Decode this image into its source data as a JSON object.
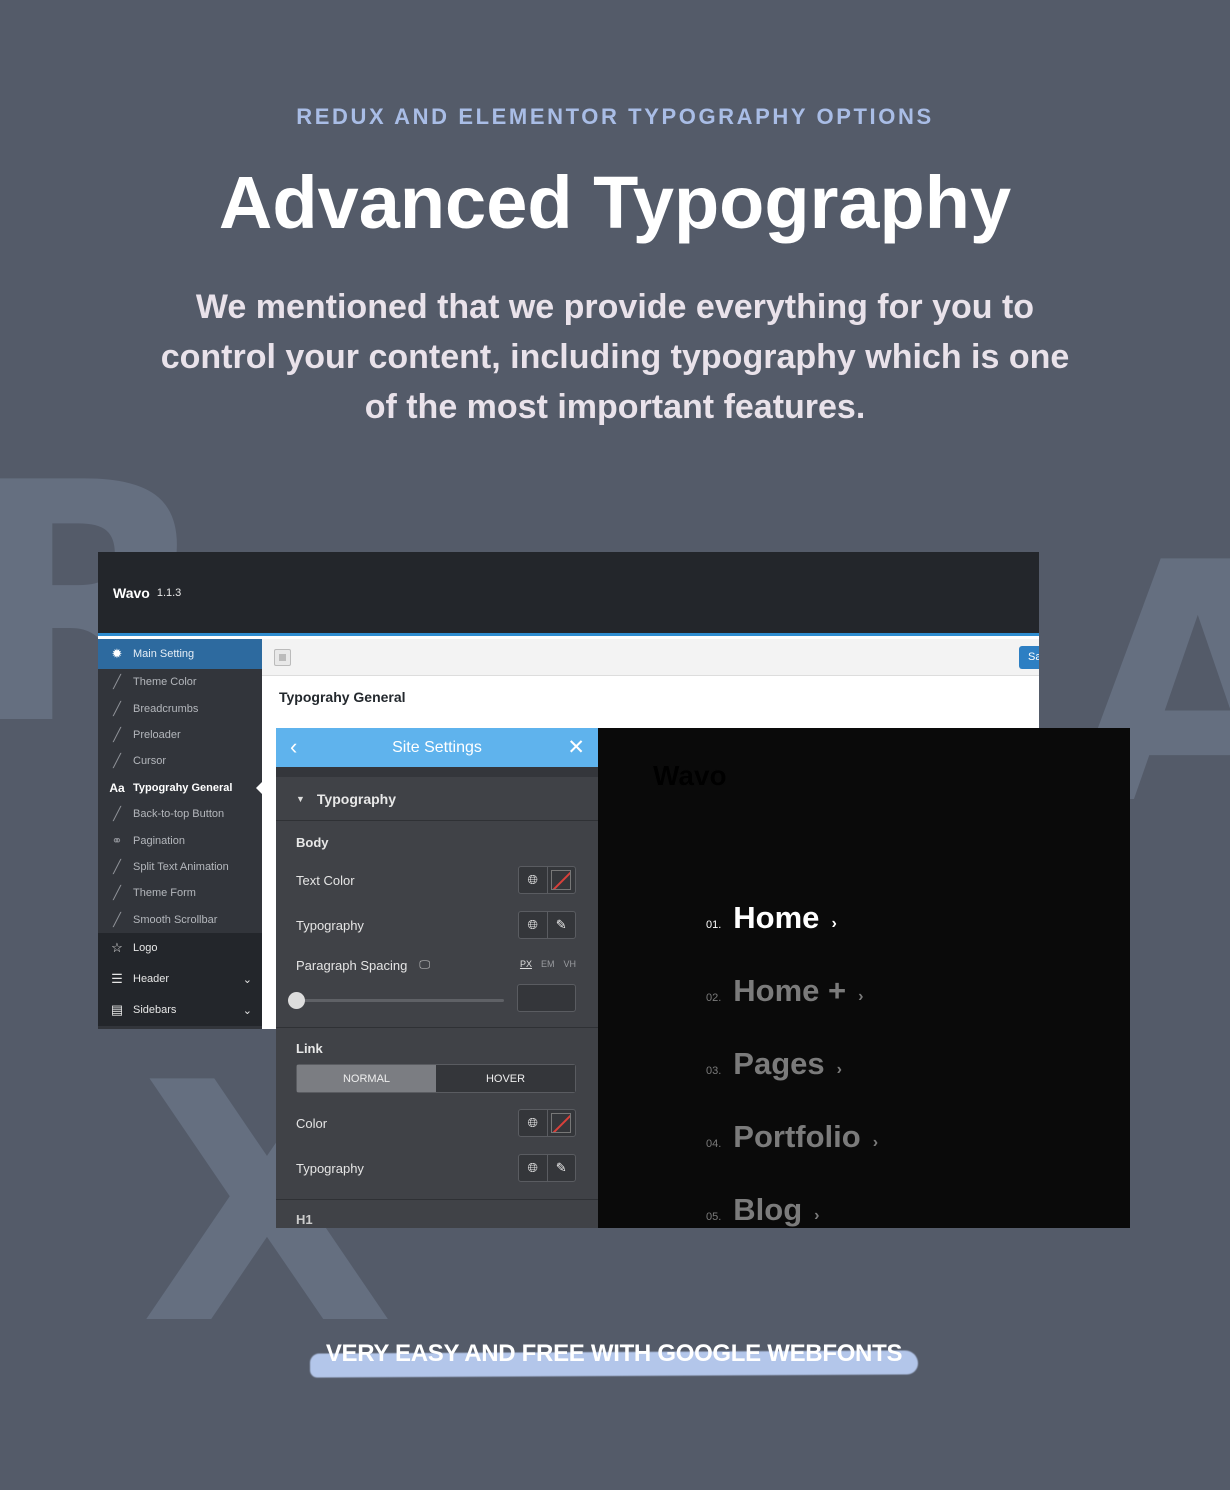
{
  "hero": {
    "eyebrow": "REDUX AND ELEMENTOR TYPOGRAPHY OPTIONS",
    "title": "Advanced Typography",
    "subtitle": "We mentioned that we provide everything for you to control your content, including typography which is one of the most important features."
  },
  "background_letters": [
    "R",
    "A",
    "X"
  ],
  "redux": {
    "brand": "Wavo",
    "version": "1.1.3",
    "save_label": "Save",
    "heading": "Typograhy General",
    "sidebar": [
      {
        "label": "Main Setting",
        "icon": "gear-icon"
      },
      {
        "label": "Theme Color",
        "icon": "brush-icon"
      },
      {
        "label": "Breadcrumbs",
        "icon": "brush-icon"
      },
      {
        "label": "Preloader",
        "icon": "brush-icon"
      },
      {
        "label": "Cursor",
        "icon": "brush-icon"
      },
      {
        "label": "Typograhy General",
        "icon": "font-icon",
        "icon_text": "Aa"
      },
      {
        "label": "Back-to-top Button",
        "icon": "brush-icon"
      },
      {
        "label": "Pagination",
        "icon": "link-icon"
      },
      {
        "label": "Split Text Animation",
        "icon": "brush-icon"
      },
      {
        "label": "Theme Form",
        "icon": "brush-icon"
      },
      {
        "label": "Smooth Scrollbar",
        "icon": "brush-icon"
      },
      {
        "label": "Logo",
        "icon": "star-icon"
      },
      {
        "label": "Header",
        "icon": "menu-icon"
      },
      {
        "label": "Sidebars",
        "icon": "grid-icon"
      }
    ]
  },
  "elementor": {
    "title": "Site Settings",
    "section": "Typography",
    "body_label": "Body",
    "text_color_label": "Text Color",
    "typography_label": "Typography",
    "paragraph_spacing_label": "Paragraph Spacing",
    "units": [
      "PX",
      "EM",
      "VH"
    ],
    "selected_unit": "PX",
    "paragraph_spacing_value": "",
    "link_label": "Link",
    "tab_normal": "NORMAL",
    "tab_hover": "HOVER",
    "color_label": "Color",
    "link_typography_label": "Typography",
    "next_section": "H1"
  },
  "preview": {
    "logo": "Wavo",
    "menu": [
      {
        "num": "01.",
        "label": "Home",
        "current": true
      },
      {
        "num": "02.",
        "label": "Home +",
        "current": false
      },
      {
        "num": "03.",
        "label": "Pages",
        "current": false
      },
      {
        "num": "04.",
        "label": "Portfolio",
        "current": false
      },
      {
        "num": "05.",
        "label": "Blog",
        "current": false
      }
    ]
  },
  "footer": {
    "text": "VERY EASY AND FREE WITH GOOGLE WEBFONTS",
    "highlight_color": "#b3c6ea"
  },
  "colors": {
    "background": "#545b69",
    "accent": "#a9bde6",
    "redux_blue": "#2d6a9f",
    "elementor_blue": "#5fb3ed"
  }
}
